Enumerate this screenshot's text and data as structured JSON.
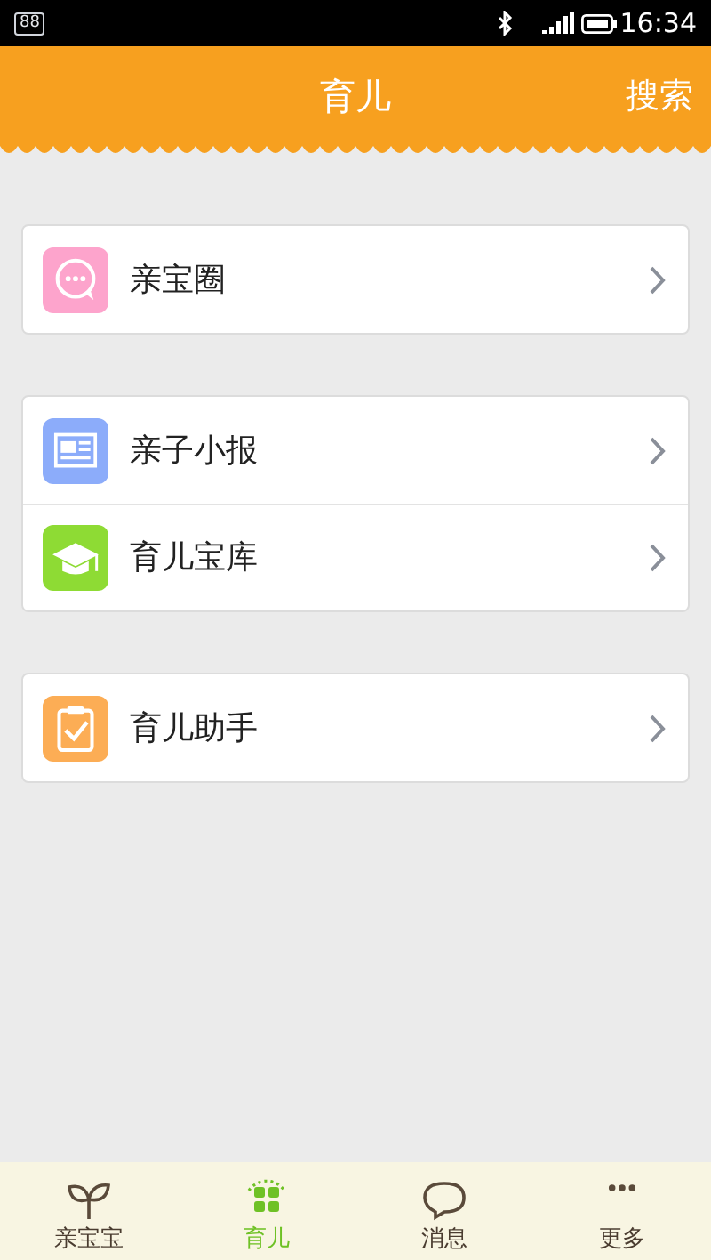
{
  "status_bar": {
    "badge": "88",
    "time": "16:34"
  },
  "header": {
    "title": "育儿",
    "action": "搜索"
  },
  "groups": [
    {
      "items": [
        {
          "kind": "chat",
          "color": "#fda4cc",
          "label": "亲宝圈"
        }
      ]
    },
    {
      "items": [
        {
          "kind": "news",
          "color": "#8cacfa",
          "label": "亲子小报"
        },
        {
          "kind": "cap",
          "color": "#8edb34",
          "label": "育儿宝库"
        }
      ]
    },
    {
      "items": [
        {
          "kind": "clipboard",
          "color": "#fcad55",
          "label": "育儿助手"
        }
      ]
    }
  ],
  "tabs": [
    {
      "kind": "sprout",
      "label": "亲宝宝",
      "selected": false
    },
    {
      "kind": "grid",
      "label": "育儿",
      "selected": true
    },
    {
      "kind": "bubble",
      "label": "消息",
      "selected": false
    },
    {
      "kind": "dots",
      "label": "更多",
      "selected": false
    }
  ]
}
